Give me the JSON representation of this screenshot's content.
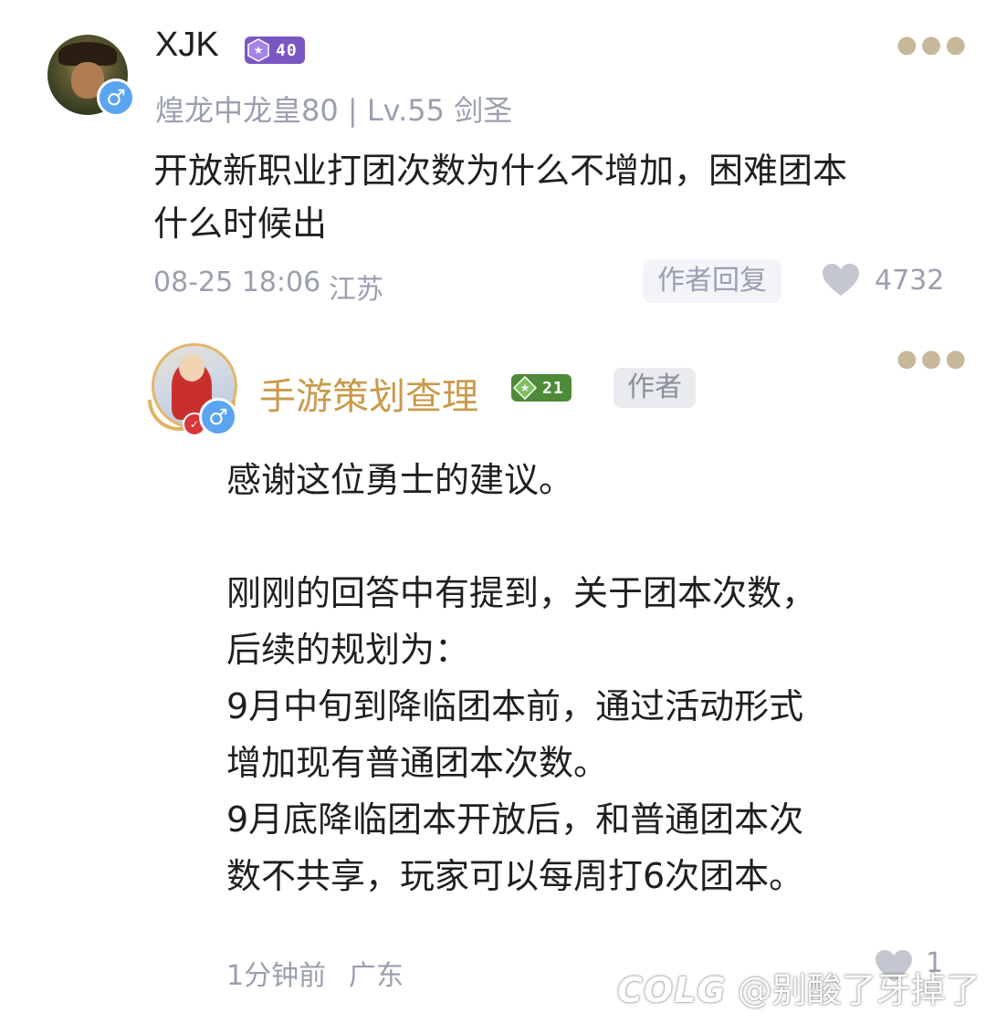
{
  "comment": {
    "username": "XJK",
    "level_badge": "40",
    "subtitle": "煌龙中龙皇80 | Lv.55 剑圣",
    "text": "开放新职业打团次数为什么不增加，困难团本什么时候出",
    "time": "08-25 18:06",
    "location": "江苏",
    "reply_tag": "作者回复",
    "likes": "4732",
    "gender_symbol": "♂",
    "more_icon": "more-dots-icon"
  },
  "reply": {
    "username": "手游策划查理",
    "level_badge": "21",
    "author_tag": "作者",
    "text": "感谢这位勇士的建议。\n\n刚刚的回答中有提到，关于团本次数，后续的规划为：\n9月中旬到降临团本前，通过活动形式增加现有普通团本次数。\n9月底降临团本开放后，和普通团本次数不共享，玩家可以每周打6次团本。",
    "time": "1分钟前",
    "location": "广东",
    "likes": "1",
    "gender_symbol": "♂"
  },
  "watermark": {
    "brand": "COLG",
    "handle": "@别酸了牙掉了"
  },
  "colors": {
    "meta_gray": "#9a9fb0",
    "author_gold": "#c99a4a",
    "level_purple": "#7b57c6",
    "level_green": "#4f8a3a",
    "gender_blue": "#5aa4f0"
  }
}
